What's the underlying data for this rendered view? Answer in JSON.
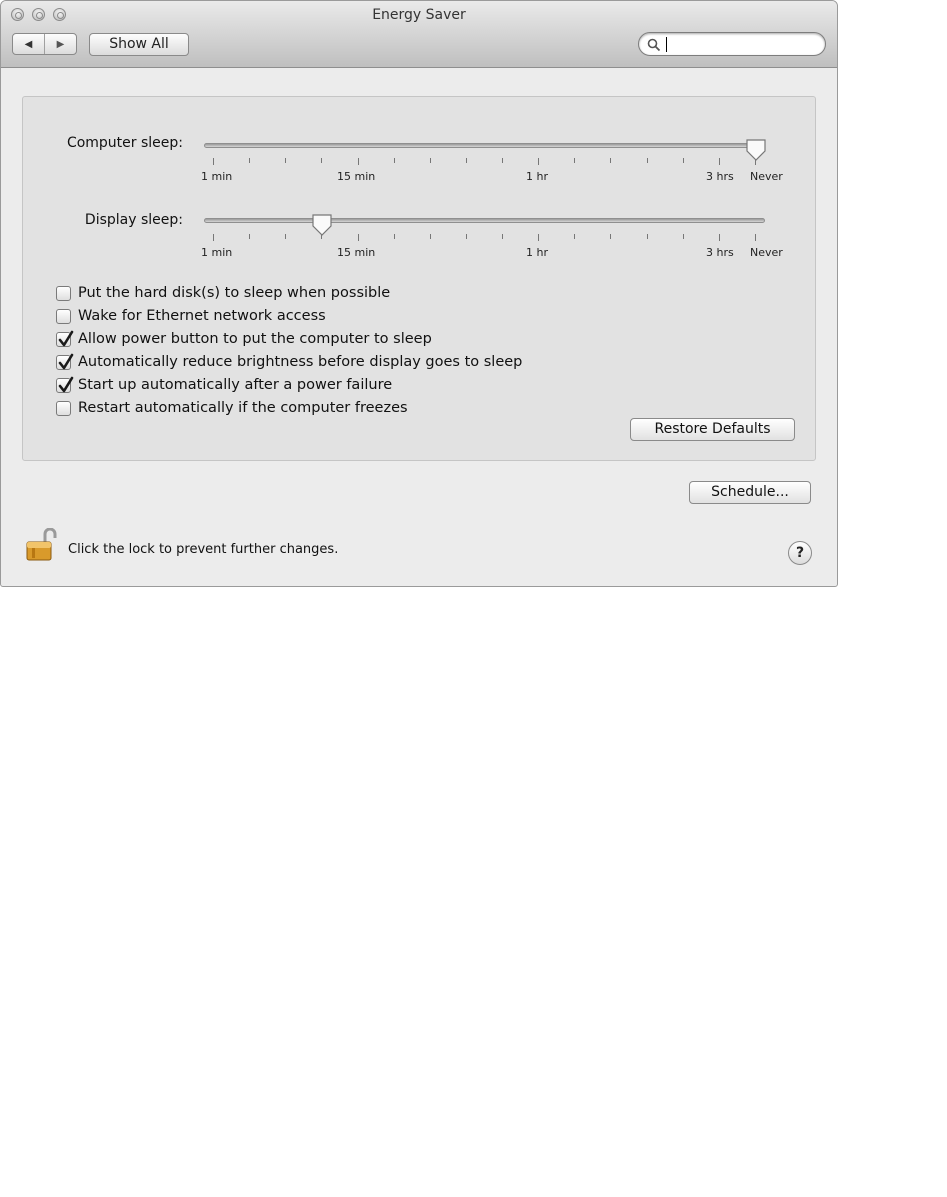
{
  "window": {
    "title": "Energy Saver"
  },
  "toolbar": {
    "back_icon": "back-arrow-icon",
    "forward_icon": "forward-arrow-icon",
    "show_all_label": "Show All",
    "search_value": "",
    "search_placeholder": ""
  },
  "sliders": {
    "computer_sleep": {
      "label": "Computer sleep:",
      "value": "Never",
      "position": 1.0
    },
    "display_sleep": {
      "label": "Display sleep:",
      "value": "10 min",
      "position": 0.21
    },
    "tick_labels": [
      "1 min",
      "15 min",
      "1 hr",
      "3 hrs",
      "Never"
    ]
  },
  "options": [
    {
      "label": "Put the hard disk(s) to sleep when possible",
      "checked": false
    },
    {
      "label": "Wake for Ethernet network access",
      "checked": false
    },
    {
      "label": "Allow power button to put the computer to sleep",
      "checked": true
    },
    {
      "label": "Automatically reduce brightness before display goes to sleep",
      "checked": true
    },
    {
      "label": "Start up automatically after a power failure",
      "checked": true
    },
    {
      "label": "Restart automatically if the computer freezes",
      "checked": false
    }
  ],
  "buttons": {
    "restore_defaults": "Restore Defaults",
    "schedule": "Schedule..."
  },
  "footer": {
    "lock_text": "Click the lock to prevent further changes.",
    "lock_icon": "unlocked-padlock-icon",
    "help_label": "?"
  },
  "colors": {
    "window_bg": "#ececec",
    "panel_bg": "#e2e2e2",
    "check": "#1a1a1a"
  }
}
